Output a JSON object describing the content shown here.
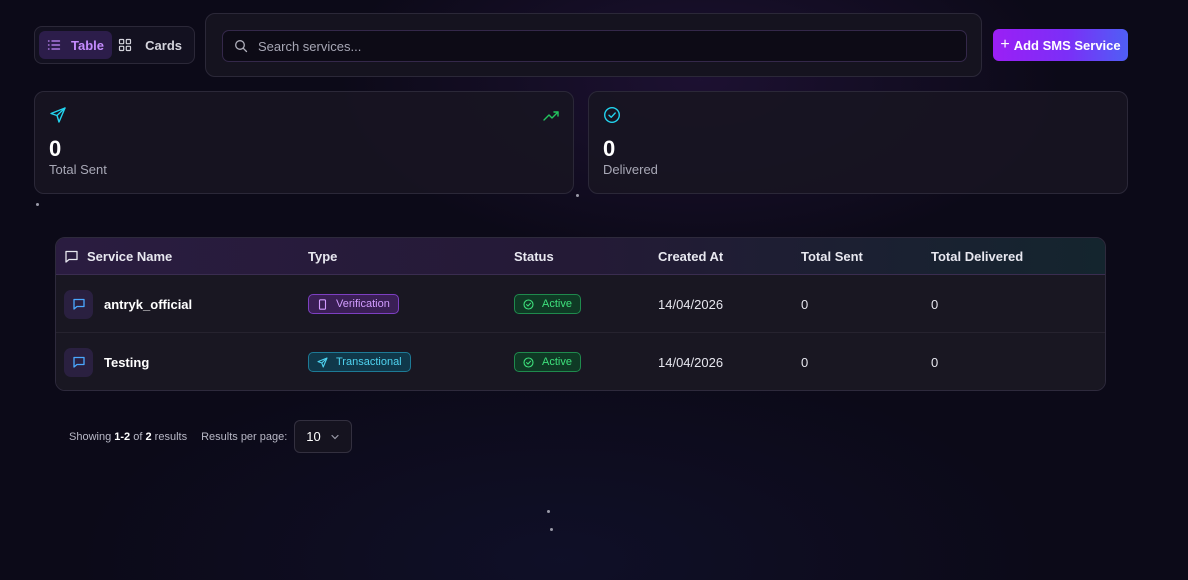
{
  "view_toggle": {
    "table_label": "Table",
    "cards_label": "Cards",
    "active": "Table"
  },
  "search": {
    "placeholder": "Search services..."
  },
  "add_button": {
    "label": "Add SMS Service"
  },
  "stats": [
    {
      "value": "0",
      "label": "Total Sent",
      "icon": "send-icon",
      "accent": "#22d3ee"
    },
    {
      "value": "0",
      "label": "Delivered",
      "icon": "check-circle-icon",
      "accent": "#22d3ee"
    }
  ],
  "table": {
    "headers": [
      "Service Name",
      "Type",
      "Status",
      "Created At",
      "Total Sent",
      "Total Delivered"
    ],
    "rows": [
      {
        "name": "antryk_official",
        "type": "Verification",
        "status": "Active",
        "created_at": "14/04/2026",
        "total_sent": "0",
        "total_delivered": "0"
      },
      {
        "name": "Testing",
        "type": "Transactional",
        "status": "Active",
        "created_at": "14/04/2026",
        "total_sent": "0",
        "total_delivered": "0"
      }
    ]
  },
  "pagination": {
    "showing_prefix": "Showing",
    "range": "1-2",
    "of_text": "of",
    "total": "2",
    "results_text": "results",
    "per_page_label": "Results per page:",
    "per_page_value": "10"
  },
  "colors": {
    "accent_purple": "#9b1ff5",
    "verification_badge": "#d29cff",
    "transactional_badge": "#4fd3f0",
    "active_badge": "#3ee07c",
    "trend_green": "#22c55e"
  }
}
